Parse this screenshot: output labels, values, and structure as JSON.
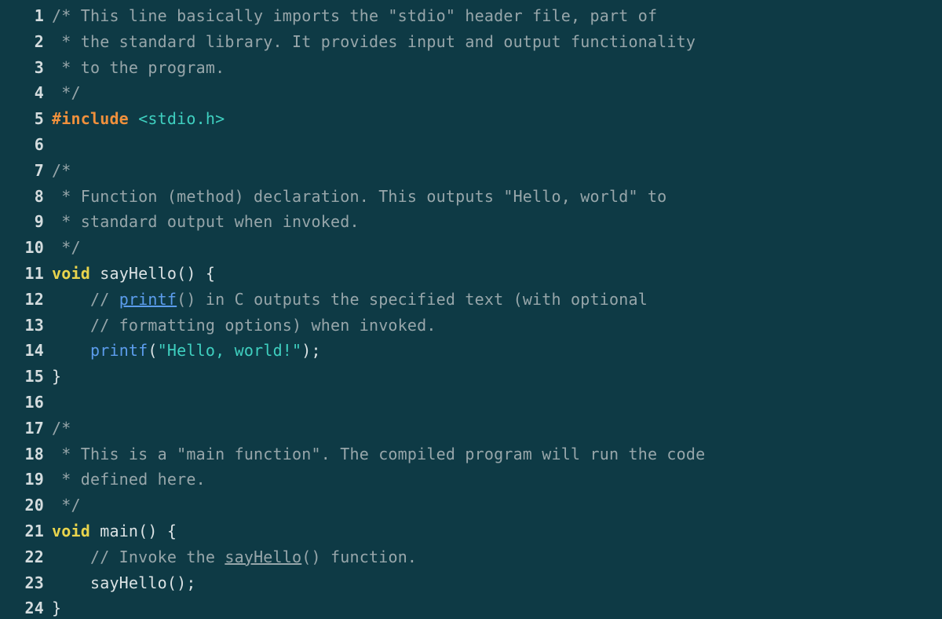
{
  "editor": {
    "language": "C",
    "background_color": "#0e3a45",
    "gutter_color": "#d4dcde",
    "colors": {
      "comment": "#97a6aa",
      "plain": "#dbe2e4",
      "keyword": "#e8d44d",
      "preprocessor": "#f0903c",
      "include_path": "#3fd0c0",
      "string": "#3fd0c0",
      "function": "#5c9ded",
      "link": "#5c9ded"
    },
    "first_line_number": 1,
    "last_line_number": 24,
    "total_lines": 24
  },
  "lines": [
    {
      "number": "1",
      "tokens": [
        {
          "text": "/* This line basically imports the \"stdio\" header file, part of",
          "kind": "comment"
        }
      ]
    },
    {
      "number": "2",
      "tokens": [
        {
          "text": " * the standard library. It provides input and output functionality",
          "kind": "comment"
        }
      ]
    },
    {
      "number": "3",
      "tokens": [
        {
          "text": " * to the program.",
          "kind": "comment"
        }
      ]
    },
    {
      "number": "4",
      "tokens": [
        {
          "text": " */",
          "kind": "comment"
        }
      ]
    },
    {
      "number": "5",
      "tokens": [
        {
          "text": "#include",
          "kind": "preproc"
        },
        {
          "text": " ",
          "kind": "plain"
        },
        {
          "text": "<stdio.h>",
          "kind": "include"
        }
      ]
    },
    {
      "number": "6",
      "tokens": [
        {
          "text": "",
          "kind": "plain"
        }
      ]
    },
    {
      "number": "7",
      "tokens": [
        {
          "text": "/*",
          "kind": "comment"
        }
      ]
    },
    {
      "number": "8",
      "tokens": [
        {
          "text": " * Function (method) declaration. This outputs \"Hello, world\" to",
          "kind": "comment"
        }
      ]
    },
    {
      "number": "9",
      "tokens": [
        {
          "text": " * standard output when invoked.",
          "kind": "comment"
        }
      ]
    },
    {
      "number": "10",
      "tokens": [
        {
          "text": " */",
          "kind": "comment"
        }
      ]
    },
    {
      "number": "11",
      "tokens": [
        {
          "text": "void",
          "kind": "keyword"
        },
        {
          "text": " sayHello() {",
          "kind": "plain"
        }
      ]
    },
    {
      "number": "12",
      "tokens": [
        {
          "text": "    // ",
          "kind": "comment"
        },
        {
          "text": "printf",
          "kind": "link"
        },
        {
          "text": "() in C outputs the specified text (with optional",
          "kind": "comment"
        }
      ]
    },
    {
      "number": "13",
      "tokens": [
        {
          "text": "    // formatting options) when invoked.",
          "kind": "comment"
        }
      ]
    },
    {
      "number": "14",
      "tokens": [
        {
          "text": "    ",
          "kind": "plain"
        },
        {
          "text": "printf",
          "kind": "func"
        },
        {
          "text": "(",
          "kind": "plain"
        },
        {
          "text": "\"Hello, world!\"",
          "kind": "string"
        },
        {
          "text": ");",
          "kind": "plain"
        }
      ]
    },
    {
      "number": "15",
      "tokens": [
        {
          "text": "}",
          "kind": "plain"
        }
      ]
    },
    {
      "number": "16",
      "tokens": [
        {
          "text": "",
          "kind": "plain"
        }
      ]
    },
    {
      "number": "17",
      "tokens": [
        {
          "text": "/*",
          "kind": "comment"
        }
      ]
    },
    {
      "number": "18",
      "tokens": [
        {
          "text": " * This is a \"main function\". The compiled program will run the code",
          "kind": "comment"
        }
      ]
    },
    {
      "number": "19",
      "tokens": [
        {
          "text": " * defined here.",
          "kind": "comment"
        }
      ]
    },
    {
      "number": "20",
      "tokens": [
        {
          "text": " */",
          "kind": "comment"
        }
      ]
    },
    {
      "number": "21",
      "tokens": [
        {
          "text": "void",
          "kind": "keyword"
        },
        {
          "text": " main() {",
          "kind": "plain"
        }
      ]
    },
    {
      "number": "22",
      "tokens": [
        {
          "text": "    // Invoke the ",
          "kind": "comment"
        },
        {
          "text": "sayHello",
          "kind": "link-comment"
        },
        {
          "text": "() function.",
          "kind": "comment"
        }
      ]
    },
    {
      "number": "23",
      "tokens": [
        {
          "text": "    sayHello();",
          "kind": "plain"
        }
      ]
    },
    {
      "number": "24",
      "tokens": [
        {
          "text": "}",
          "kind": "plain"
        }
      ]
    }
  ]
}
